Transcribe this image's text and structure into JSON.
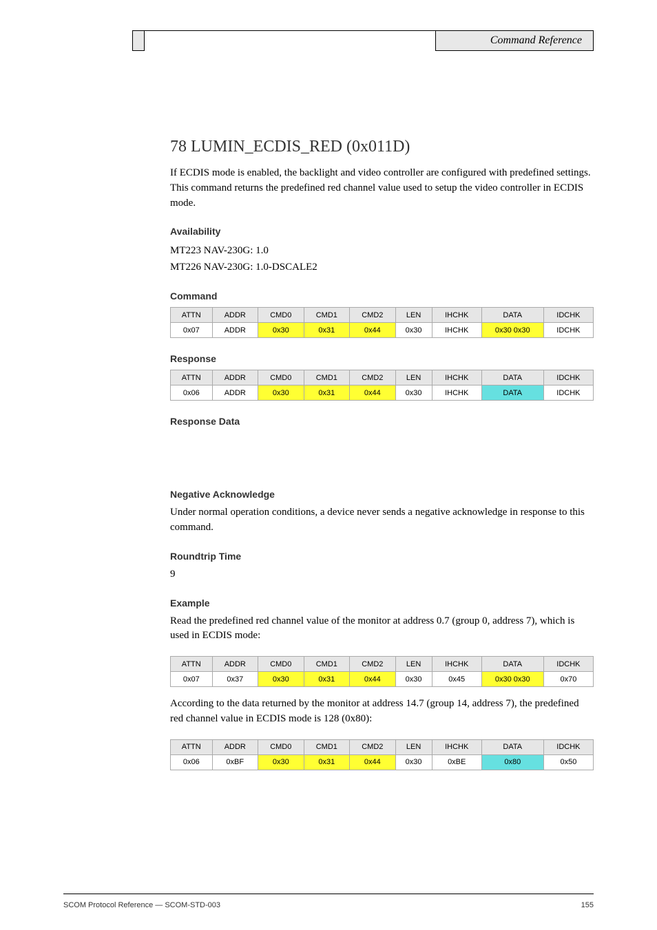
{
  "header": {
    "title": "Command Reference"
  },
  "sec_title": "78 LUMIN_ECDIS_RED (0x011D)",
  "desc": "If ECDIS mode is enabled, the backlight and video controller are configured with predefined settings. This command returns the predefined red channel value used to setup the video controller in ECDIS mode.",
  "avail_h": "Availability",
  "avail1": "MT223 NAV-230G: 1.0",
  "avail2": "MT226 NAV-230G: 1.0-DSCALE2",
  "cmd_h": "Command",
  "resp_h": "Response",
  "cols": [
    "ATTN",
    "ADDR",
    "CMD0",
    "CMD1",
    "CMD2",
    "LEN",
    "IHCHK",
    "DATA",
    "IDCHK"
  ],
  "cmd_row": [
    "0x07",
    "ADDR",
    "0x30",
    "0x31",
    "0x44",
    "0x30",
    "IHCHK",
    "0x30 0x30",
    "IDCHK"
  ],
  "resp_row": [
    "0x06",
    "ADDR",
    "0x30",
    "0x31",
    "0x44",
    "0x30",
    "IHCHK",
    "DATA",
    "IDCHK"
  ],
  "cmd_classes": [
    "",
    "",
    "y",
    "y",
    "y",
    "",
    "",
    "y y",
    ""
  ],
  "resp_classes": [
    "",
    "",
    "y",
    "y",
    "y",
    "",
    "",
    "c",
    ""
  ],
  "resp_data_h": "Response Data",
  "resp_data_txt": "",
  "nak_h": "Negative Acknowledge",
  "nak_txt": "Under normal operation conditions, a device never sends a negative acknowledge in response to this command.",
  "rtt_h": "Roundtrip Time",
  "rtt_txt": "9",
  "ex_h": "Example",
  "ex1_txt": "Read the predefined red channel value of the monitor at address 0.7 (group 0, address 7), which is used in ECDIS mode:",
  "ex1_row": [
    "0x07",
    "0x37",
    "0x30",
    "0x31",
    "0x44",
    "0x30",
    "0x45",
    "0x30 0x30",
    "0x70"
  ],
  "ex1_classes": [
    "",
    "",
    "y",
    "y",
    "y",
    "",
    "",
    "y y",
    ""
  ],
  "ex2_txt": "According to the data returned by the monitor at address 14.7 (group 14, address 7), the predefined red channel value in ECDIS mode is 128 (0x80):",
  "ex2_row": [
    "0x06",
    "0xBF",
    "0x30",
    "0x31",
    "0x44",
    "0x30",
    "0xBE",
    "0x80",
    "0x50"
  ],
  "ex2_classes": [
    "",
    "",
    "y",
    "y",
    "y",
    "",
    "",
    "c",
    ""
  ],
  "footer": {
    "left": "SCOM Protocol Reference — SCOM-STD-003",
    "right": "155"
  }
}
